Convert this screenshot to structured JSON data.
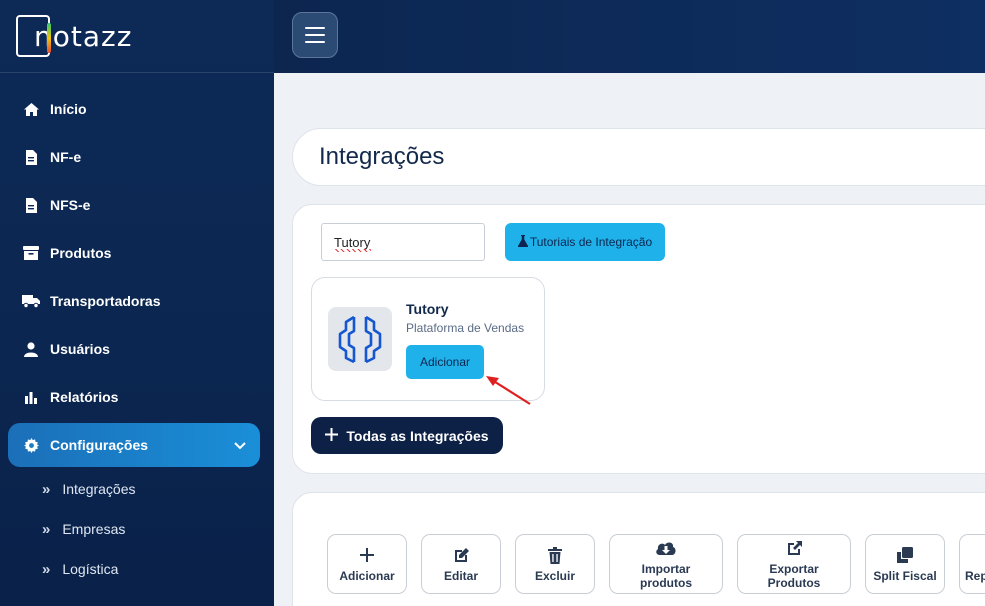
{
  "brand": {
    "name": "notazz"
  },
  "sidebar": {
    "items": [
      {
        "label": "Início",
        "icon": "home-icon"
      },
      {
        "label": "NF-e",
        "icon": "file-icon"
      },
      {
        "label": "NFS-e",
        "icon": "file-icon"
      },
      {
        "label": "Produtos",
        "icon": "archive-icon"
      },
      {
        "label": "Transportadoras",
        "icon": "truck-icon"
      },
      {
        "label": "Usuários",
        "icon": "user-icon"
      },
      {
        "label": "Relatórios",
        "icon": "bar-chart-icon"
      },
      {
        "label": "Configurações",
        "icon": "gear-icon",
        "active": true
      }
    ],
    "sub_items": [
      {
        "label": "Integrações"
      },
      {
        "label": "Empresas"
      },
      {
        "label": "Logística"
      }
    ]
  },
  "page": {
    "title": "Integrações"
  },
  "integrations": {
    "search_value": "Tutory",
    "tutorial_label": "Tutoriais de Integração",
    "app": {
      "name": "Tutory",
      "subtitle": "Plataforma de Vendas",
      "add_label": "Adicionar"
    },
    "all_label": "Todas as Integrações"
  },
  "products_toolbar": {
    "buttons": [
      {
        "label": "Adicionar",
        "icon": "plus-icon"
      },
      {
        "label": "Editar",
        "icon": "edit-icon"
      },
      {
        "label": "Excluir",
        "icon": "trash-icon"
      },
      {
        "label": "Importar produtos",
        "icon": "cloud-download-icon"
      },
      {
        "label": "Exportar Produtos",
        "icon": "external-link-icon"
      },
      {
        "label": "Split Fiscal",
        "icon": "copy-icon"
      },
      {
        "label": "Repl",
        "icon": "replicate-icon"
      }
    ]
  },
  "colors": {
    "accent": "#1fb2ea",
    "navy": "#0d2146",
    "sidebar": "#0d2a57"
  }
}
